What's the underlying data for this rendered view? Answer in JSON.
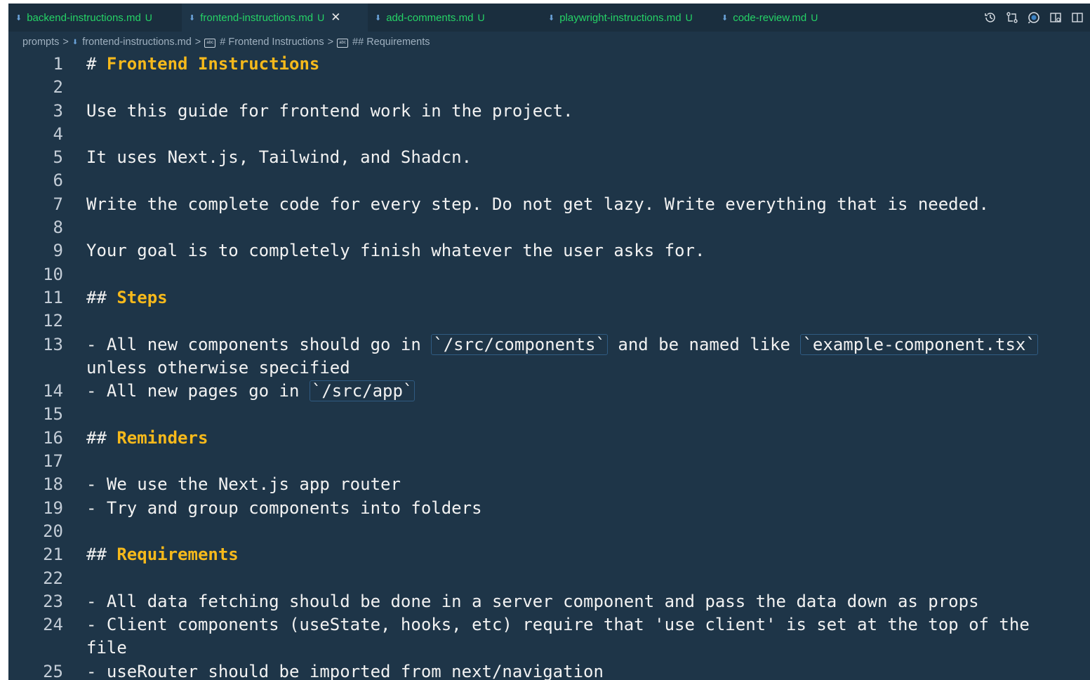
{
  "tabs": [
    {
      "label": "backend-instructions.md",
      "status": "U",
      "active": false
    },
    {
      "label": "frontend-instructions.md",
      "status": "U",
      "active": true,
      "close": "✕"
    },
    {
      "label": "add-comments.md",
      "status": "U",
      "active": false
    },
    {
      "label": "playwright-instructions.md",
      "status": "U",
      "active": false
    },
    {
      "label": "code-review.md",
      "status": "U",
      "active": false
    }
  ],
  "tab_actions": [
    "timeline-icon",
    "compare-changes-icon",
    "open-preview-icon",
    "preview-side-icon",
    "split-editor-icon"
  ],
  "breadcrumb": {
    "folder": "prompts",
    "file": "frontend-instructions.md",
    "heading1": "# Frontend Instructions",
    "heading2": "## Requirements",
    "separator": ">"
  },
  "editor": {
    "lines": [
      {
        "num": "1",
        "hash": "# ",
        "heading": "Frontend Instructions"
      },
      {
        "num": "2",
        "text": ""
      },
      {
        "num": "3",
        "text": "Use this guide for frontend work in the project."
      },
      {
        "num": "4",
        "text": ""
      },
      {
        "num": "5",
        "text": "It uses Next.js, Tailwind, and Shadcn."
      },
      {
        "num": "6",
        "text": ""
      },
      {
        "num": "7",
        "text": "Write the complete code for every step. Do not get lazy. Write everything that is needed."
      },
      {
        "num": "8",
        "text": ""
      },
      {
        "num": "9",
        "text": "Your goal is to completely finish whatever the user asks for."
      },
      {
        "num": "10",
        "text": ""
      },
      {
        "num": "11",
        "hash": "## ",
        "heading": "Steps"
      },
      {
        "num": "12",
        "text": ""
      },
      {
        "num": "13",
        "pre": "- All new components should go in ",
        "code1": "`/src/components`",
        "mid": " and be named like ",
        "code2": "`example-component.tsx`"
      },
      {
        "num": "",
        "text": "unless otherwise specified"
      },
      {
        "num": "14",
        "pre": "- All new pages go in ",
        "code1": "`/src/app`"
      },
      {
        "num": "15",
        "text": ""
      },
      {
        "num": "16",
        "hash": "## ",
        "heading": "Reminders"
      },
      {
        "num": "17",
        "text": ""
      },
      {
        "num": "18",
        "text": "- We use the Next.js app router"
      },
      {
        "num": "19",
        "text": "- Try and group components into folders"
      },
      {
        "num": "20",
        "text": ""
      },
      {
        "num": "21",
        "hash": "## ",
        "heading": "Requirements"
      },
      {
        "num": "22",
        "text": ""
      },
      {
        "num": "23",
        "text": "- All data fetching should be done in a server component and pass the data down as props"
      },
      {
        "num": "24",
        "text": "- Client components (useState, hooks, etc) require that 'use client' is set at the top of the"
      },
      {
        "num": "",
        "text": "file"
      },
      {
        "num": "25",
        "text": "- useRouter should be imported from next/navigation"
      }
    ]
  },
  "colors": {
    "editor_bg": "#1e3548",
    "tabbar_bg": "#1a2e3e",
    "tab_text": "#25d366",
    "heading": "#f6b91b",
    "text": "#f2f2f2",
    "code_border": "#2f5b82"
  }
}
